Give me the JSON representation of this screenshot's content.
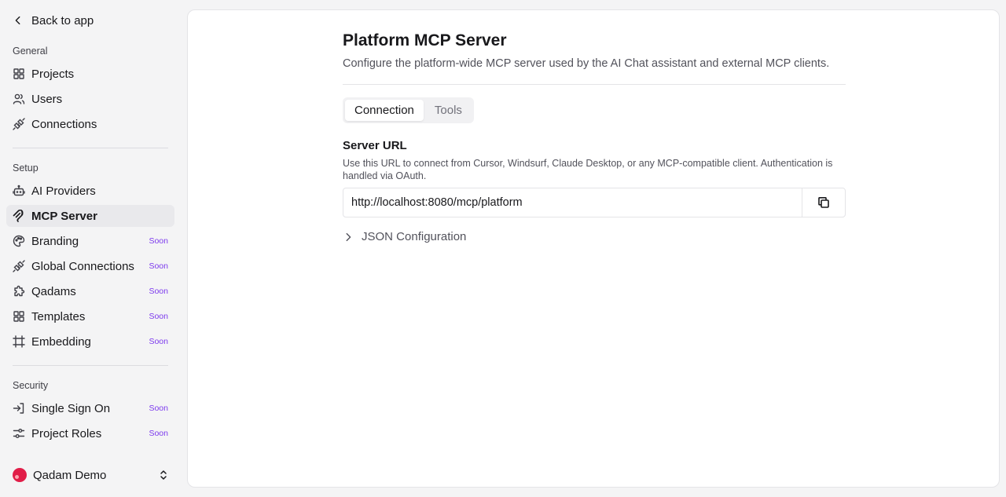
{
  "sidebar": {
    "back_label": "Back to app",
    "sections": {
      "general": "General",
      "setup": "Setup",
      "security": "Security"
    },
    "items": {
      "projects": "Projects",
      "users": "Users",
      "connections": "Connections",
      "ai_providers": "AI Providers",
      "mcp_server": "MCP Server",
      "branding": "Branding",
      "global_connections": "Global Connections",
      "qadams": "Qadams",
      "templates": "Templates",
      "embedding": "Embedding",
      "single_sign_on": "Single Sign On",
      "project_roles": "Project Roles"
    },
    "soon_label": "Soon",
    "workspace": "Qadam Demo"
  },
  "page": {
    "title": "Platform MCP Server",
    "subtitle": "Configure the platform-wide MCP server used by the AI Chat assistant and external MCP clients.",
    "tabs": [
      "Connection",
      "Tools"
    ],
    "active_tab": "Connection",
    "server_url_label": "Server URL",
    "server_url_help": "Use this URL to connect from Cursor, Windsurf, Claude Desktop, or any MCP-compatible client. Authentication is handled via OAuth.",
    "server_url_value": "http://localhost:8080/mcp/platform",
    "json_config_label": "JSON Configuration"
  },
  "colors": {
    "accent_soon": "#7c3aed",
    "active_bg": "#e9e9ec",
    "workspace_avatar": "#e11d48"
  },
  "icons": {
    "back": "chevron-left-icon",
    "projects": "grid-icon",
    "users": "users-icon",
    "connections": "plug-icon",
    "ai_providers": "bot-icon",
    "mcp_server": "mcp-icon",
    "branding": "palette-icon",
    "global_connections": "plug-icon",
    "qadams": "puzzle-icon",
    "templates": "grid-icon",
    "embedding": "hash-icon",
    "single_sign_on": "login-icon",
    "project_roles": "sliders-icon",
    "copy": "copy-icon",
    "expand": "chevron-right-icon",
    "workspace_switch": "chevron-up-down-icon"
  }
}
